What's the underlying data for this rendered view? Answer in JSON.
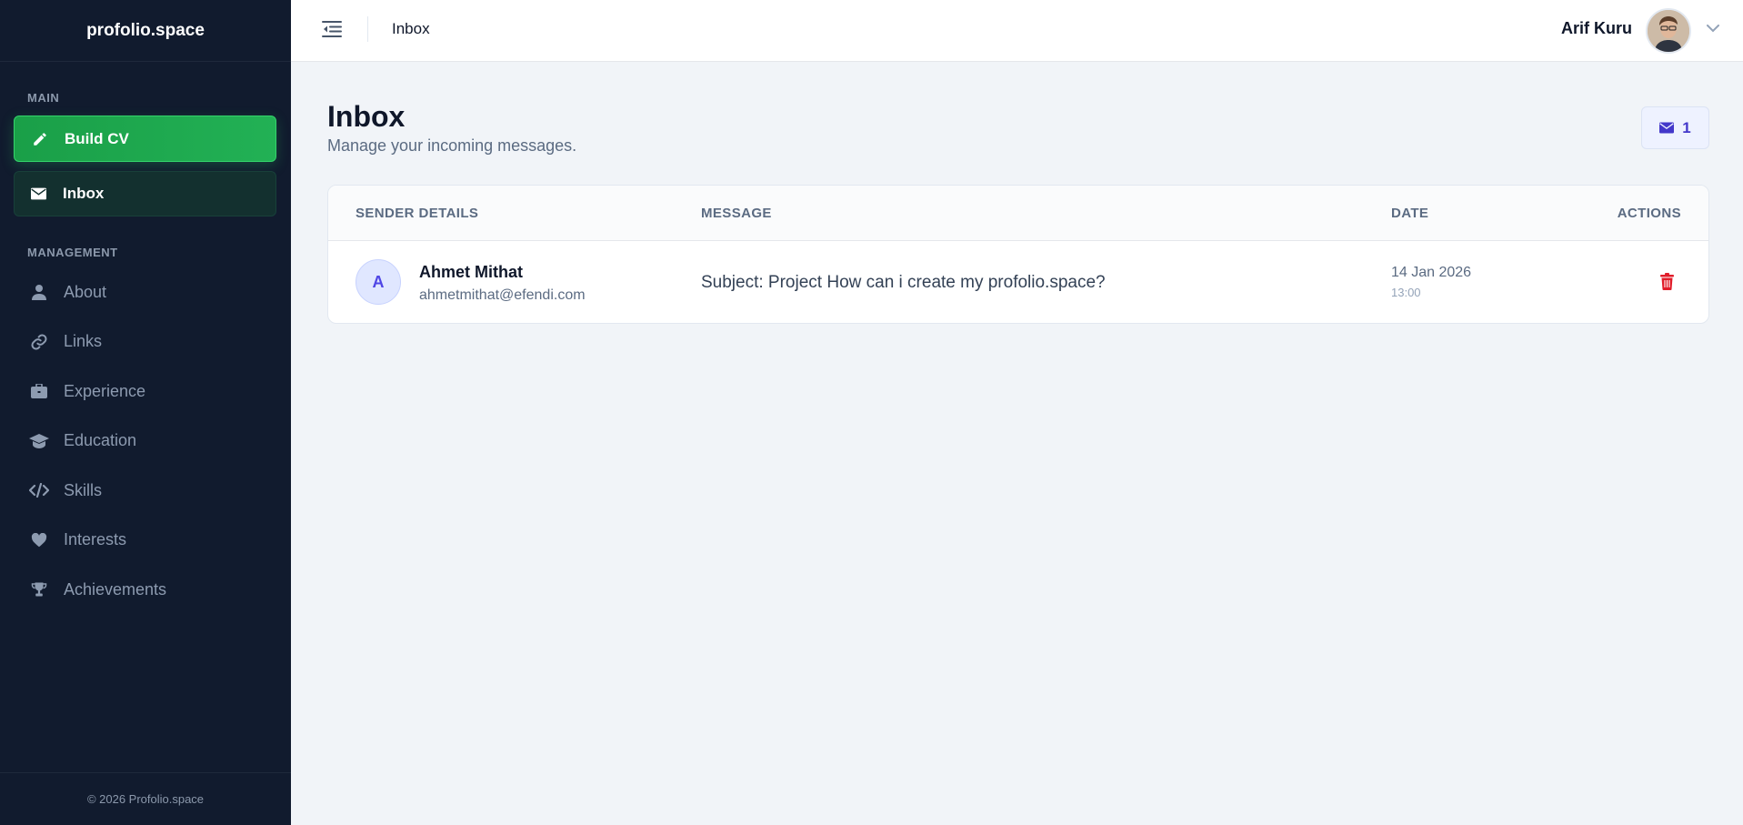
{
  "sidebar": {
    "brand": "profolio.space",
    "section_main": "MAIN",
    "build_cv": "Build CV",
    "inbox": "Inbox",
    "section_management": "MANAGEMENT",
    "items": [
      {
        "label": "About",
        "icon": "user-icon"
      },
      {
        "label": "Links",
        "icon": "link-icon"
      },
      {
        "label": "Experience",
        "icon": "briefcase-icon"
      },
      {
        "label": "Education",
        "icon": "graduation-cap-icon"
      },
      {
        "label": "Skills",
        "icon": "code-icon"
      },
      {
        "label": "Interests",
        "icon": "heart-icon"
      },
      {
        "label": "Achievements",
        "icon": "trophy-icon"
      }
    ],
    "footer": "© 2026 Profolio.space"
  },
  "topbar": {
    "breadcrumb": "Inbox",
    "user_name": "Arif Kuru"
  },
  "main": {
    "title": "Inbox",
    "subtitle": "Manage your incoming messages.",
    "message_count": "1"
  },
  "table": {
    "columns": [
      "SENDER DETAILS",
      "MESSAGE",
      "DATE",
      "ACTIONS"
    ],
    "rows": [
      {
        "initial": "A",
        "name": "Ahmet Mithat",
        "email": "ahmetmithat@efendi.com",
        "message": "Subject: Project How can i create my profolio.space?",
        "date": "14 Jan 2026",
        "time": "13:00"
      }
    ]
  },
  "colors": {
    "sidebar_bg": "#111b2e",
    "accent_green": "#22b155",
    "accent_indigo": "#4338ca",
    "danger": "#e11d2a"
  }
}
